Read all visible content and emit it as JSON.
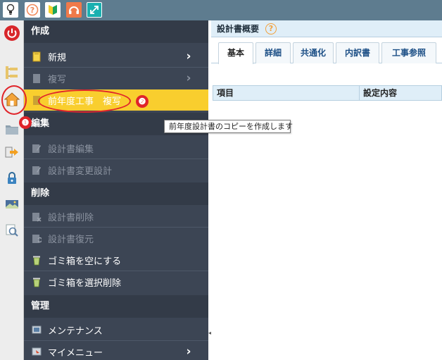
{
  "toolbar": {
    "buttons": [
      {
        "icon": "lightbulb-icon",
        "color": "#ffffff"
      },
      {
        "icon": "help-icon",
        "color": "#f08a5a"
      },
      {
        "icon": "beginner-mark-icon",
        "color": "#1aa35a"
      },
      {
        "icon": "support-headset-icon",
        "color": "#f07a4a"
      },
      {
        "icon": "expand-icon",
        "color": "#1ab0b0"
      }
    ]
  },
  "menu": {
    "sections": {
      "create": "作成",
      "edit": "編集",
      "delete": "削除",
      "manage": "管理"
    },
    "items": {
      "new": "新規",
      "copy": "複写",
      "prev_year_copy": "前年度工事　複写",
      "edit_doc": "設計書編集",
      "change_design": "設計書変更設計",
      "delete_doc": "設計書削除",
      "restore_doc": "設計書復元",
      "empty_trash": "ゴミ箱を空にする",
      "select_delete_trash": "ゴミ箱を選択削除",
      "maintenance": "メンテナンス",
      "my_menu": "マイメニュー"
    },
    "active_color": "#f9ce2e"
  },
  "tooltip": {
    "text": "前年度設計書のコピーを作成します"
  },
  "panel": {
    "title": "設計書概要",
    "help_glyph": "?",
    "tabs": [
      "基本",
      "詳細",
      "共通化",
      "内訳書",
      "工事参照"
    ],
    "active_tab": "基本",
    "table_headers": [
      "項目",
      "設定内容"
    ]
  },
  "annotations": {
    "mark1": "❶",
    "mark2": "❷",
    "color": "#e0242a"
  }
}
